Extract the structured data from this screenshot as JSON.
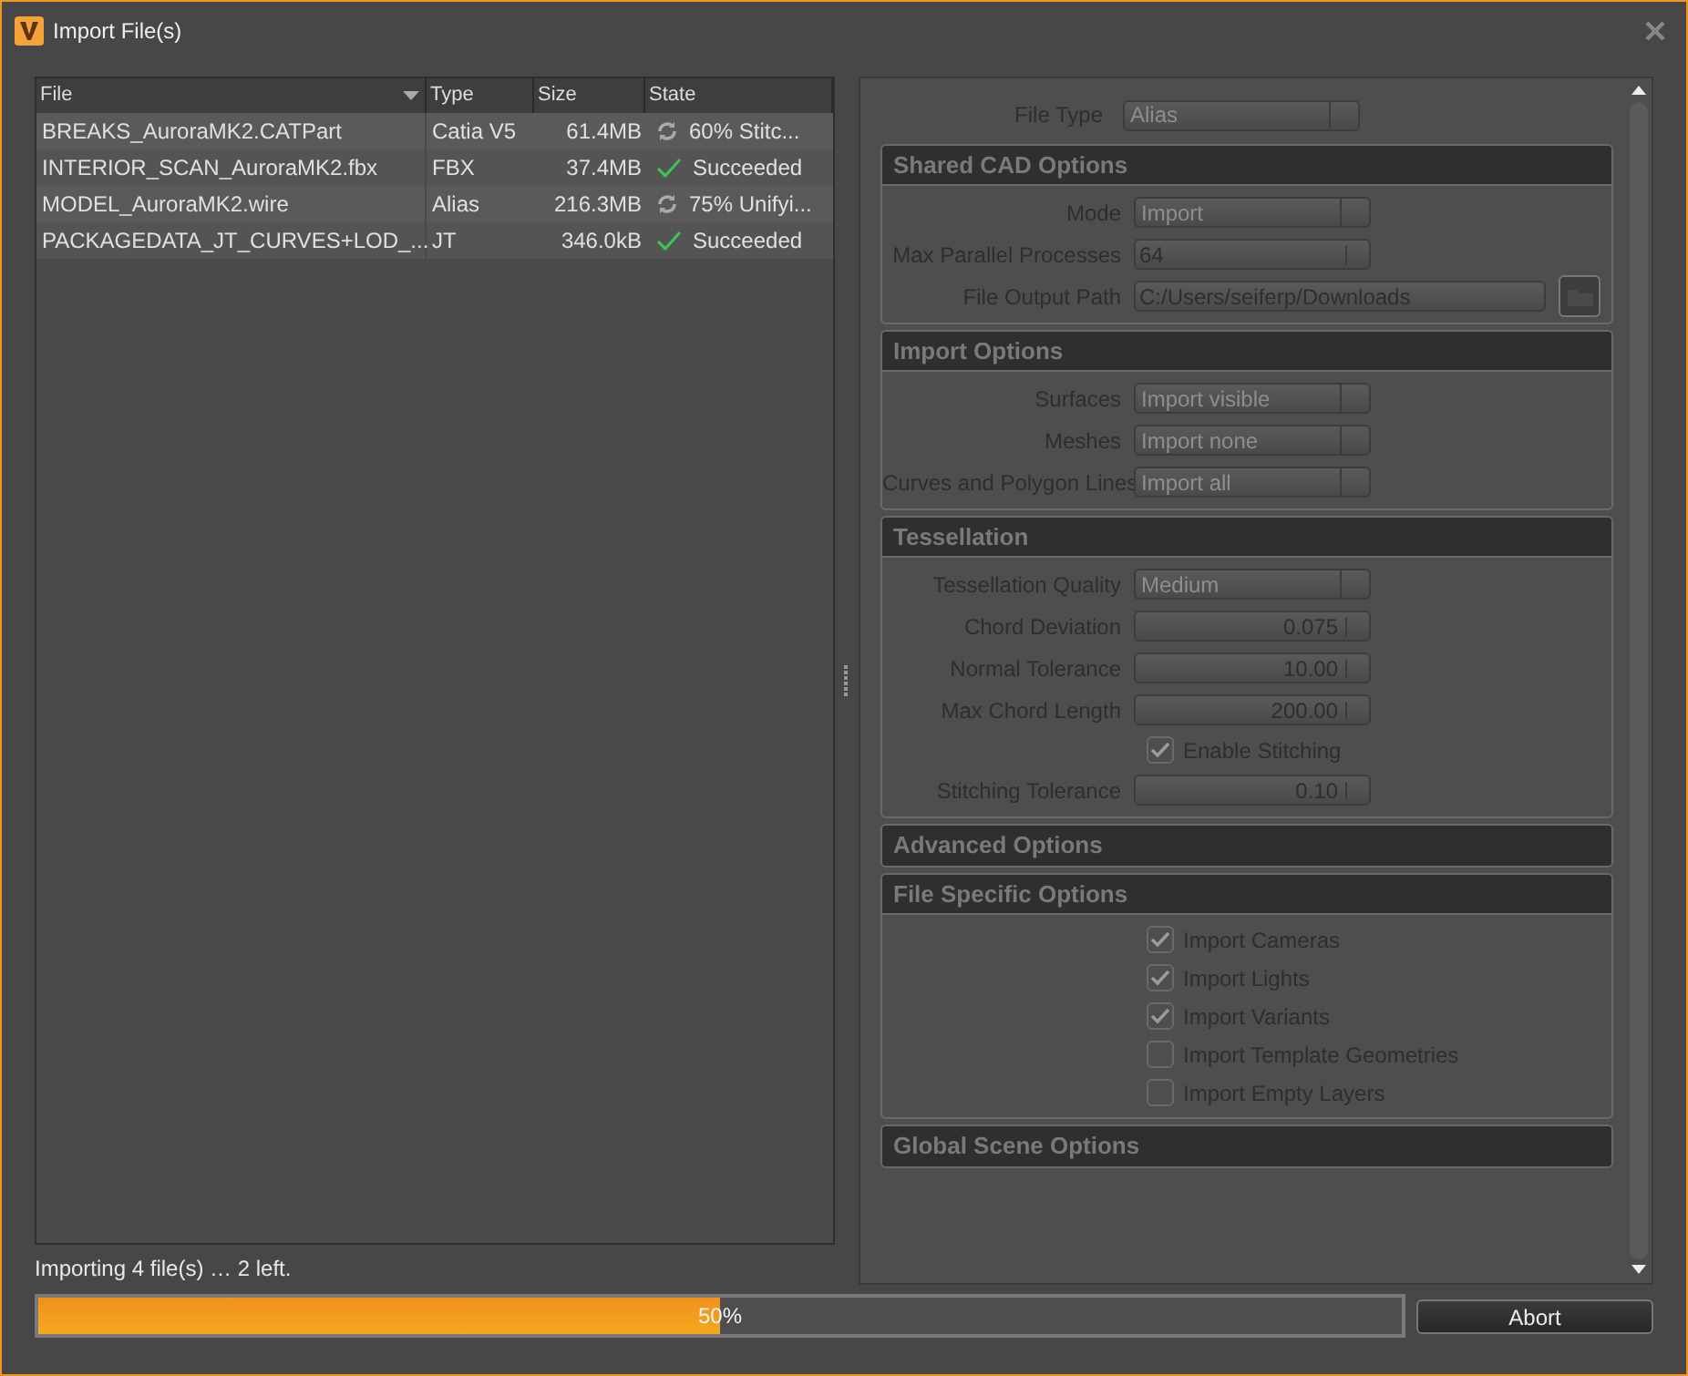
{
  "window": {
    "title": "Import File(s)"
  },
  "table": {
    "columns": [
      {
        "label": "File",
        "sort_indicator": true
      },
      {
        "label": "Type",
        "sort_indicator": false
      },
      {
        "label": "Size",
        "sort_indicator": false
      },
      {
        "label": "State",
        "sort_indicator": false
      }
    ],
    "rows": [
      {
        "file": "BREAKS_AuroraMK2.CATPart",
        "type": "Catia V5",
        "size": "61.4MB",
        "kind": "progress",
        "state": "60% Stitc..."
      },
      {
        "file": "INTERIOR_SCAN_AuroraMK2.fbx",
        "type": "FBX",
        "size": "37.4MB",
        "kind": "done",
        "state": "Succeeded"
      },
      {
        "file": "MODEL_AuroraMK2.wire",
        "type": "Alias",
        "size": "216.3MB",
        "kind": "progress",
        "state": "75% Unifyi..."
      },
      {
        "file": "PACKAGEDATA_JT_CURVES+LOD_...",
        "type": "JT",
        "size": "346.0kB",
        "kind": "done",
        "state": "Succeeded"
      }
    ]
  },
  "status": "Importing 4 file(s) … 2 left.",
  "options": {
    "disabled": true,
    "file_type": {
      "label": "File Type",
      "value": "Alias"
    },
    "sections": [
      {
        "title": "Shared CAD Options",
        "expanded": true,
        "rows": [
          {
            "kind": "dropdown",
            "label": "Mode",
            "value": "Import"
          },
          {
            "kind": "editable",
            "label": "Max Parallel Processes",
            "value": "64"
          },
          {
            "kind": "path",
            "label": "File Output Path",
            "value": "C:/Users/seiferp/Downloads"
          }
        ]
      },
      {
        "title": "Import Options",
        "expanded": true,
        "rows": [
          {
            "kind": "dropdown",
            "label": "Surfaces",
            "value": "Import visible"
          },
          {
            "kind": "dropdown",
            "label": "Meshes",
            "value": "Import none"
          },
          {
            "kind": "dropdown",
            "label": "Curves and Polygon Lines",
            "value": "Import all"
          }
        ]
      },
      {
        "title": "Tessellation",
        "expanded": true,
        "rows": [
          {
            "kind": "dropdown",
            "label": "Tessellation Quality",
            "value": "Medium"
          },
          {
            "kind": "number",
            "label": "Chord Deviation",
            "value": "0.075"
          },
          {
            "kind": "number",
            "label": "Normal Tolerance",
            "value": "10.00"
          },
          {
            "kind": "number",
            "label": "Max Chord Length",
            "value": "200.00"
          },
          {
            "kind": "checkbox",
            "label": "Enable Stitching",
            "checked": true
          },
          {
            "kind": "number",
            "label": "Stitching Tolerance",
            "value": "0.10"
          }
        ]
      },
      {
        "title": "Advanced Options",
        "expanded": false
      },
      {
        "title": "File Specific Options",
        "expanded": true,
        "rows": [
          {
            "kind": "checkbox",
            "label": "Import Cameras",
            "checked": true
          },
          {
            "kind": "checkbox",
            "label": "Import Lights",
            "checked": true
          },
          {
            "kind": "checkbox",
            "label": "Import Variants",
            "checked": true
          },
          {
            "kind": "checkbox",
            "label": "Import Template Geometries",
            "checked": false
          },
          {
            "kind": "checkbox",
            "label": "Import Empty Layers",
            "checked": false
          }
        ]
      },
      {
        "title": "Global Scene Options",
        "expanded": false
      }
    ]
  },
  "progress": {
    "level": 0.5,
    "text": "50%"
  },
  "abort_button": "Abort"
}
